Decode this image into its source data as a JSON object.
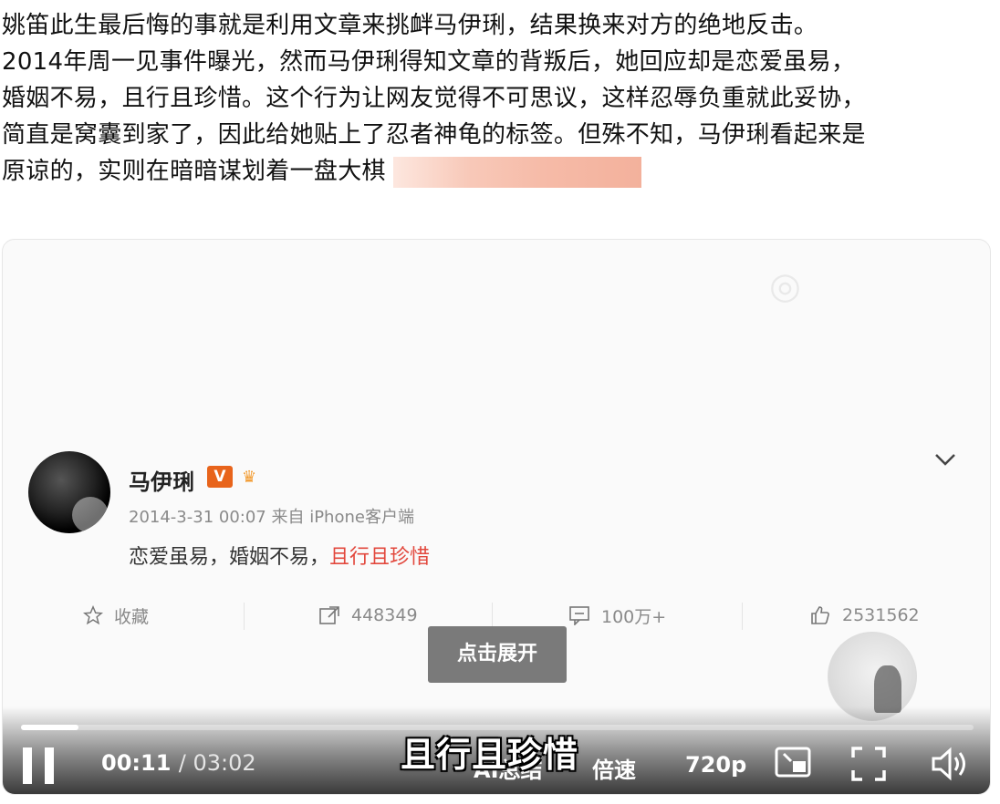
{
  "article": {
    "line1": "姚笛此生最后悔的事就是利用文章来挑衅马伊琍，结果换来对方的绝地反击。",
    "line2": "2014年周一见事件曝光，然而马伊琍得知文章的背叛后，她回应却是恋爱虽易，",
    "line3": "婚姻不易，且行且珍惜。这个行为让网友觉得不可思议，这样忍辱负重就此妥协，",
    "line4": "简直是窝囊到家了，因此给她贴上了忍者神龟的标签。但殊不知，马伊琍看起来是",
    "line5": "原谅的，实则在暗暗谋划着一盘大棋"
  },
  "post": {
    "username": "马伊琍",
    "verified_badge": "V",
    "meta": "2014-3-31 00:07 来自 iPhone客户端",
    "content_plain": "恋爱虽易，婚姻不易，",
    "content_highlight": "且行且珍惜",
    "actions": {
      "favorite": "收藏",
      "repost_count": "448349",
      "comment_count": "100万+",
      "like_count": "2531562"
    },
    "expand_button": "点击展开"
  },
  "player": {
    "current_time": "00:11",
    "total_time": "/ 03:02",
    "ai_summary": "AI总结",
    "speed": "倍速",
    "quality": "720p",
    "subtitle": "且行且珍惜",
    "progress": 0.06,
    "icons": [
      "pause-icon",
      "pip-icon",
      "fullscreen-icon",
      "volume-icon"
    ]
  },
  "colors": {
    "highlight": "#e2483d",
    "vip_badge": "#e8641b"
  }
}
